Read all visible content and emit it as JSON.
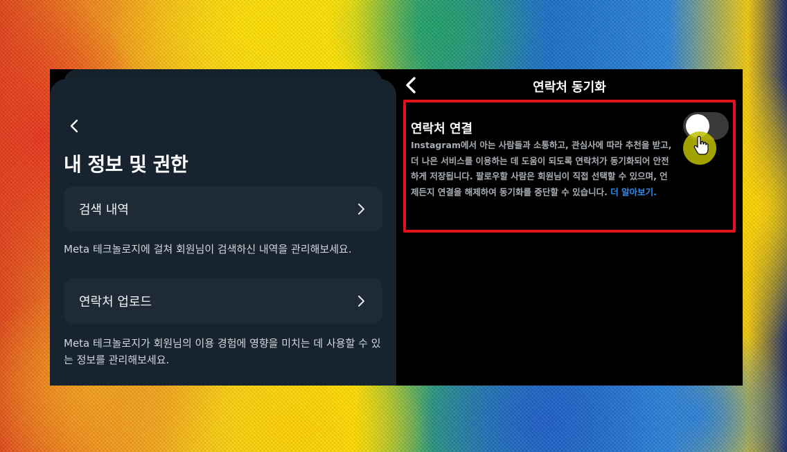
{
  "left_panel": {
    "title": "내 정보 및 권한",
    "items": [
      {
        "label": "검색 내역",
        "description": "Meta 테크놀로지에 걸쳐 회원님이 검색하신 내역을 관리해보세요."
      },
      {
        "label": "연락처 업로드",
        "description": "Meta 테크놀로지가 회원님의 이용 경험에 영향을 미치는 데 사용할 수 있는 정보를 관리해보세요."
      }
    ]
  },
  "right_panel": {
    "title": "연락처 동기화",
    "setting": {
      "title": "연락처 연결",
      "description": "Instagram에서 아는 사람들과 소통하고, 관심사에 따라 추천을 받고, 더 나은 서비스를 이용하는 데 도움이 되도록 연락처가 동기화되어 안전하게 저장됩니다. 팔로우할 사람은 회원님이 직접 선택할 수 있으며, 언제든지 연결을 해제하여 동기화를 중단할 수 있습니다.",
      "learn_more": "더 알아보기.",
      "toggle_on": false
    }
  },
  "colors": {
    "highlight": "#e0121e",
    "link": "#2f8cf0",
    "card": "#172430",
    "row": "#1e2b37"
  },
  "icons": {
    "back": "chevron-left-icon",
    "row_arrow": "chevron-right-icon",
    "cursor": "hand-pointer-icon"
  }
}
